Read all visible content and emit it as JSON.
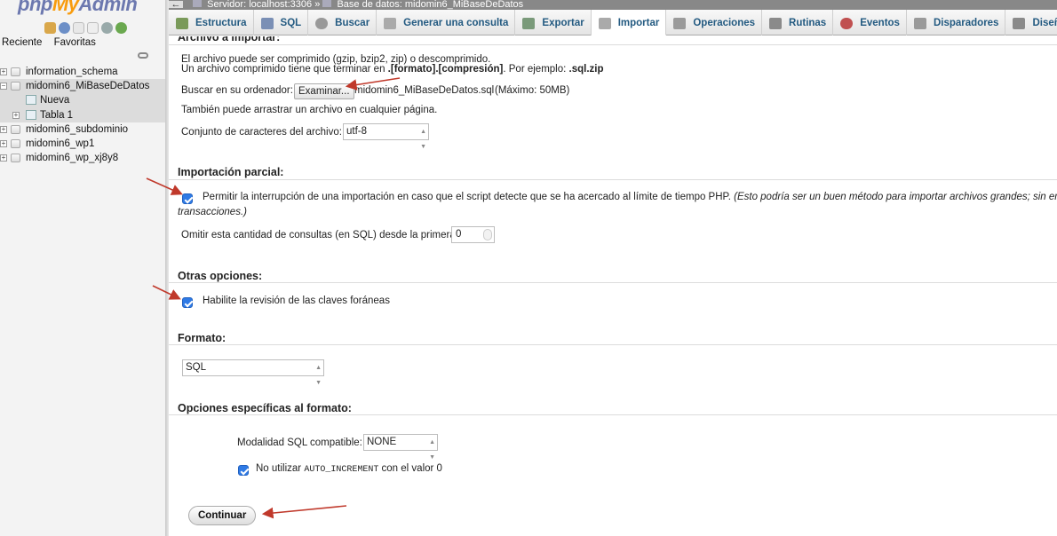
{
  "app": {
    "logo_php": "php",
    "logo_my": "My",
    "logo_admin": "Admin",
    "left_links": [
      "Reciente",
      "Favoritas"
    ]
  },
  "tree": [
    {
      "label": "information_schema",
      "level": 0
    },
    {
      "label": "midomin6_MiBaseDeDatos",
      "level": 0,
      "active": true
    },
    {
      "label": "Nueva",
      "level": 1
    },
    {
      "label": "Tabla 1",
      "level": 1
    },
    {
      "label": "midomin6_subdominio",
      "level": 0
    },
    {
      "label": "midomin6_wp1",
      "level": 0
    },
    {
      "label": "midomin6_wp_xj8y8",
      "level": 0
    }
  ],
  "breadcrumb": {
    "server": "Servidor: localhost:3306",
    "separator": "»",
    "database": "Base de datos: midomin6_MiBaseDeDatos"
  },
  "tabs": [
    {
      "label": "Estructura",
      "icon": "structure-icon",
      "color": "#7a9a5a"
    },
    {
      "label": "SQL",
      "icon": "sql-icon",
      "color": "#7a8fb5"
    },
    {
      "label": "Buscar",
      "icon": "search-icon",
      "color": "#999999"
    },
    {
      "label": "Generar una consulta",
      "icon": "query-icon",
      "color": "#9a9a9a"
    },
    {
      "label": "Exportar",
      "icon": "export-icon",
      "color": "#7a9a7a"
    },
    {
      "label": "Importar",
      "icon": "import-icon",
      "color": "#9a9a9a",
      "active": true
    },
    {
      "label": "Operaciones",
      "icon": "operations-icon",
      "color": "#9a9a9a"
    },
    {
      "label": "Rutinas",
      "icon": "routines-icon",
      "color": "#8a8a8a"
    },
    {
      "label": "Eventos",
      "icon": "events-icon",
      "color": "#c05050"
    },
    {
      "label": "Disparadores",
      "icon": "triggers-icon",
      "color": "#9a9a9a"
    },
    {
      "label": "Diseñador",
      "icon": "designer-icon",
      "color": "#8a8a8a"
    }
  ],
  "import": {
    "file_heading": "Archivo a importar:",
    "compress_line1": "El archivo puede ser comprimido (gzip, bzip2, zip) o descomprimido.",
    "compress_line2_a": "Un archivo comprimido tiene que terminar en ",
    "compress_line2_b": ".[formato].[compresión]",
    "compress_line2_c": ". Por ejemplo: ",
    "compress_line2_d": ".sql.zip",
    "browse_label": "Buscar en su ordenador:",
    "browse_button": "Examinar...",
    "file_name": "midomin6_MiBaseDeDatos.sql",
    "max_size": "(Máximo: 50MB)",
    "drag_text": "También puede arrastrar un archivo en cualquier página.",
    "charset_label": "Conjunto de caracteres del archivo:",
    "charset_value": "utf-8",
    "partial_heading": "Importación parcial:",
    "partial_checkbox_label": "Permitir la interrupción de una importación en caso que el script detecte que se ha acercado al límite de tiempo PHP.",
    "partial_note_1": "(Esto podría ser un buen método para importar archivos grandes; sin embargo, pue",
    "partial_note_2": "transacciones.)",
    "skip_label": "Omitir esta cantidad de consultas (en SQL) desde la primera:",
    "skip_value": "0",
    "other_heading": "Otras opciones:",
    "fk_label": "Habilite la revisión de las claves foráneas",
    "format_heading": "Formato:",
    "format_value": "SQL",
    "format_opts_heading": "Opciones específicas al formato:",
    "sql_compat_label": "Modalidad SQL compatible:",
    "sql_compat_value": "NONE",
    "ai_label_a": "No utilizar ",
    "ai_label_b": "AUTO_INCREMENT",
    "ai_label_c": " con el valor 0",
    "submit": "Continuar"
  },
  "colors": {
    "tab_text": "#235a81",
    "arrow": "#c0392b",
    "checkbox": "#2f7ae5"
  }
}
